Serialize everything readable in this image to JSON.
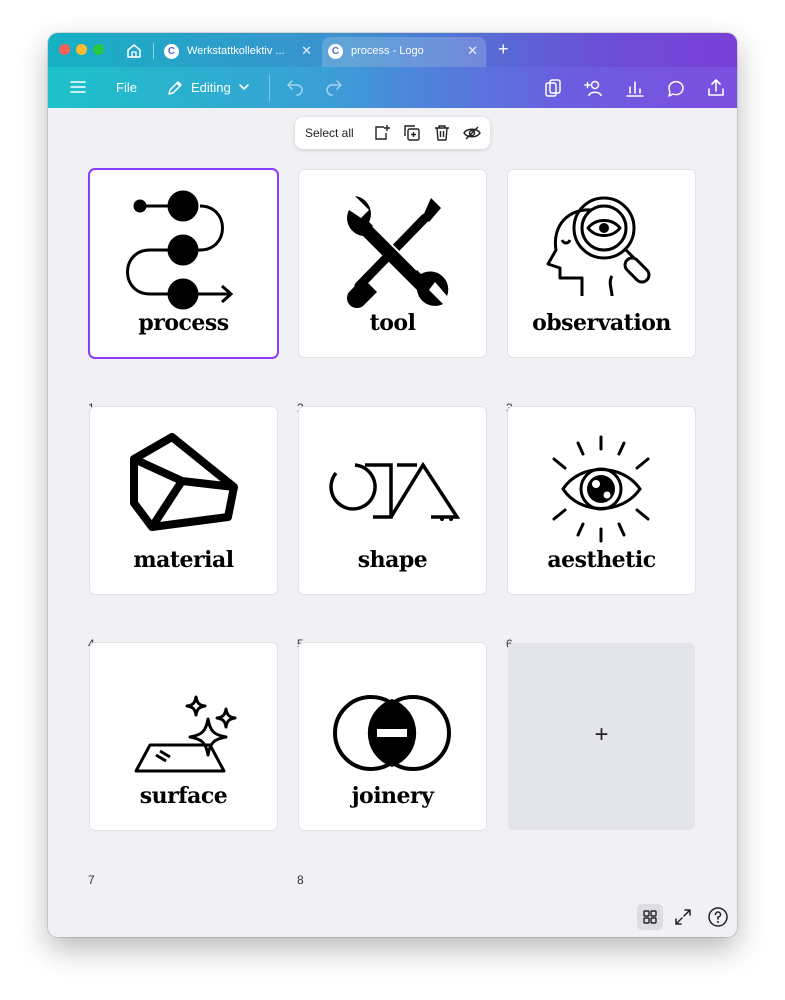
{
  "tabs": [
    {
      "title": "Werkstattkollektiv ..."
    },
    {
      "title": "process - Logo"
    }
  ],
  "toolbar": {
    "file_label": "File",
    "editing_label": "Editing"
  },
  "page_toolbar": {
    "select_all_label": "Select all"
  },
  "pages": [
    {
      "number": "1",
      "label": "process",
      "icon": "process-path-icon",
      "selected": true
    },
    {
      "number": "2",
      "label": "tool",
      "icon": "wrench-screwdriver-icon"
    },
    {
      "number": "3",
      "label": "observation",
      "icon": "head-magnifier-icon"
    },
    {
      "number": "4",
      "label": "material",
      "icon": "cube-icon"
    },
    {
      "number": "5",
      "label": "shape",
      "icon": "shapes-icon"
    },
    {
      "number": "6",
      "label": "aesthetic",
      "icon": "radiant-eye-icon"
    },
    {
      "number": "7",
      "label": "surface",
      "icon": "sparkle-surface-icon"
    },
    {
      "number": "8",
      "label": "joinery",
      "icon": "overlapping-circles-icon"
    }
  ],
  "add_page": {
    "symbol": "+"
  },
  "colors": {
    "accent": "#8b3dff",
    "titlebar_start": "#15b0c4",
    "titlebar_end": "#7a3fd6"
  }
}
